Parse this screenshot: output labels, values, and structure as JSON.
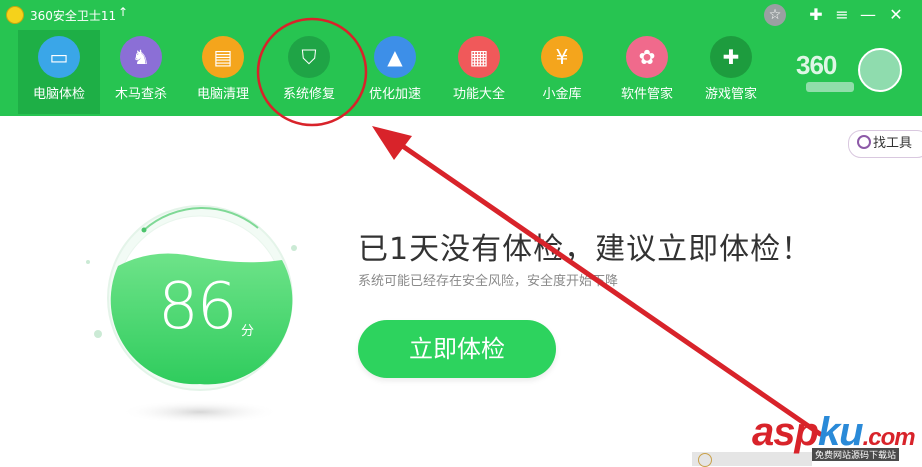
{
  "window": {
    "title": "360安全卫士11",
    "update_icon": "↑",
    "medal_icon": "☆",
    "buttons": {
      "skin": "✚",
      "menu": "≡",
      "minimize": "—",
      "close": "✕"
    }
  },
  "nav": {
    "items": [
      {
        "label": "电脑体检",
        "icon": "monitor-icon",
        "glyph": "▭",
        "color": "#3aa6e8",
        "active": true
      },
      {
        "label": "木马查杀",
        "icon": "horse-icon",
        "glyph": "♞",
        "color": "#8b6fd6",
        "active": false
      },
      {
        "label": "电脑清理",
        "icon": "broom-icon",
        "glyph": "▤",
        "color": "#f4a51c",
        "active": false
      },
      {
        "label": "系统修复",
        "icon": "shield-icon",
        "glyph": "⛉",
        "color": "#1fa446",
        "active": false
      },
      {
        "label": "优化加速",
        "icon": "rocket-icon",
        "glyph": "▲",
        "color": "#3d8fe8",
        "active": false
      },
      {
        "label": "功能大全",
        "icon": "grid-icon",
        "glyph": "▦",
        "color": "#f0595a",
        "active": false
      },
      {
        "label": "小金库",
        "icon": "money-bag-icon",
        "glyph": "¥",
        "color": "#f4a51c",
        "active": false
      },
      {
        "label": "软件管家",
        "icon": "app-grid-icon",
        "glyph": "✿",
        "color": "#f06a8c",
        "active": false
      },
      {
        "label": "游戏管家",
        "icon": "gamepad-icon",
        "glyph": "✚",
        "color": "#1d9c3e",
        "active": false
      }
    ]
  },
  "brand": {
    "logo_text": "360"
  },
  "tools": {
    "label": "找工具"
  },
  "score": {
    "value": "86",
    "unit": "分"
  },
  "main": {
    "headline": "已1天没有体检，建议立即体检！",
    "subline": "系统可能已经存在安全风险，安全度开始下降",
    "check_button": "立即体检"
  },
  "watermark": {
    "asp": "asp",
    "ku": "ku",
    "com": ".com",
    "sub": "免费网站源码下载站"
  },
  "colors": {
    "topbar": "#27c451",
    "accent": "#2dd35e",
    "annotation": "#d8232a"
  }
}
